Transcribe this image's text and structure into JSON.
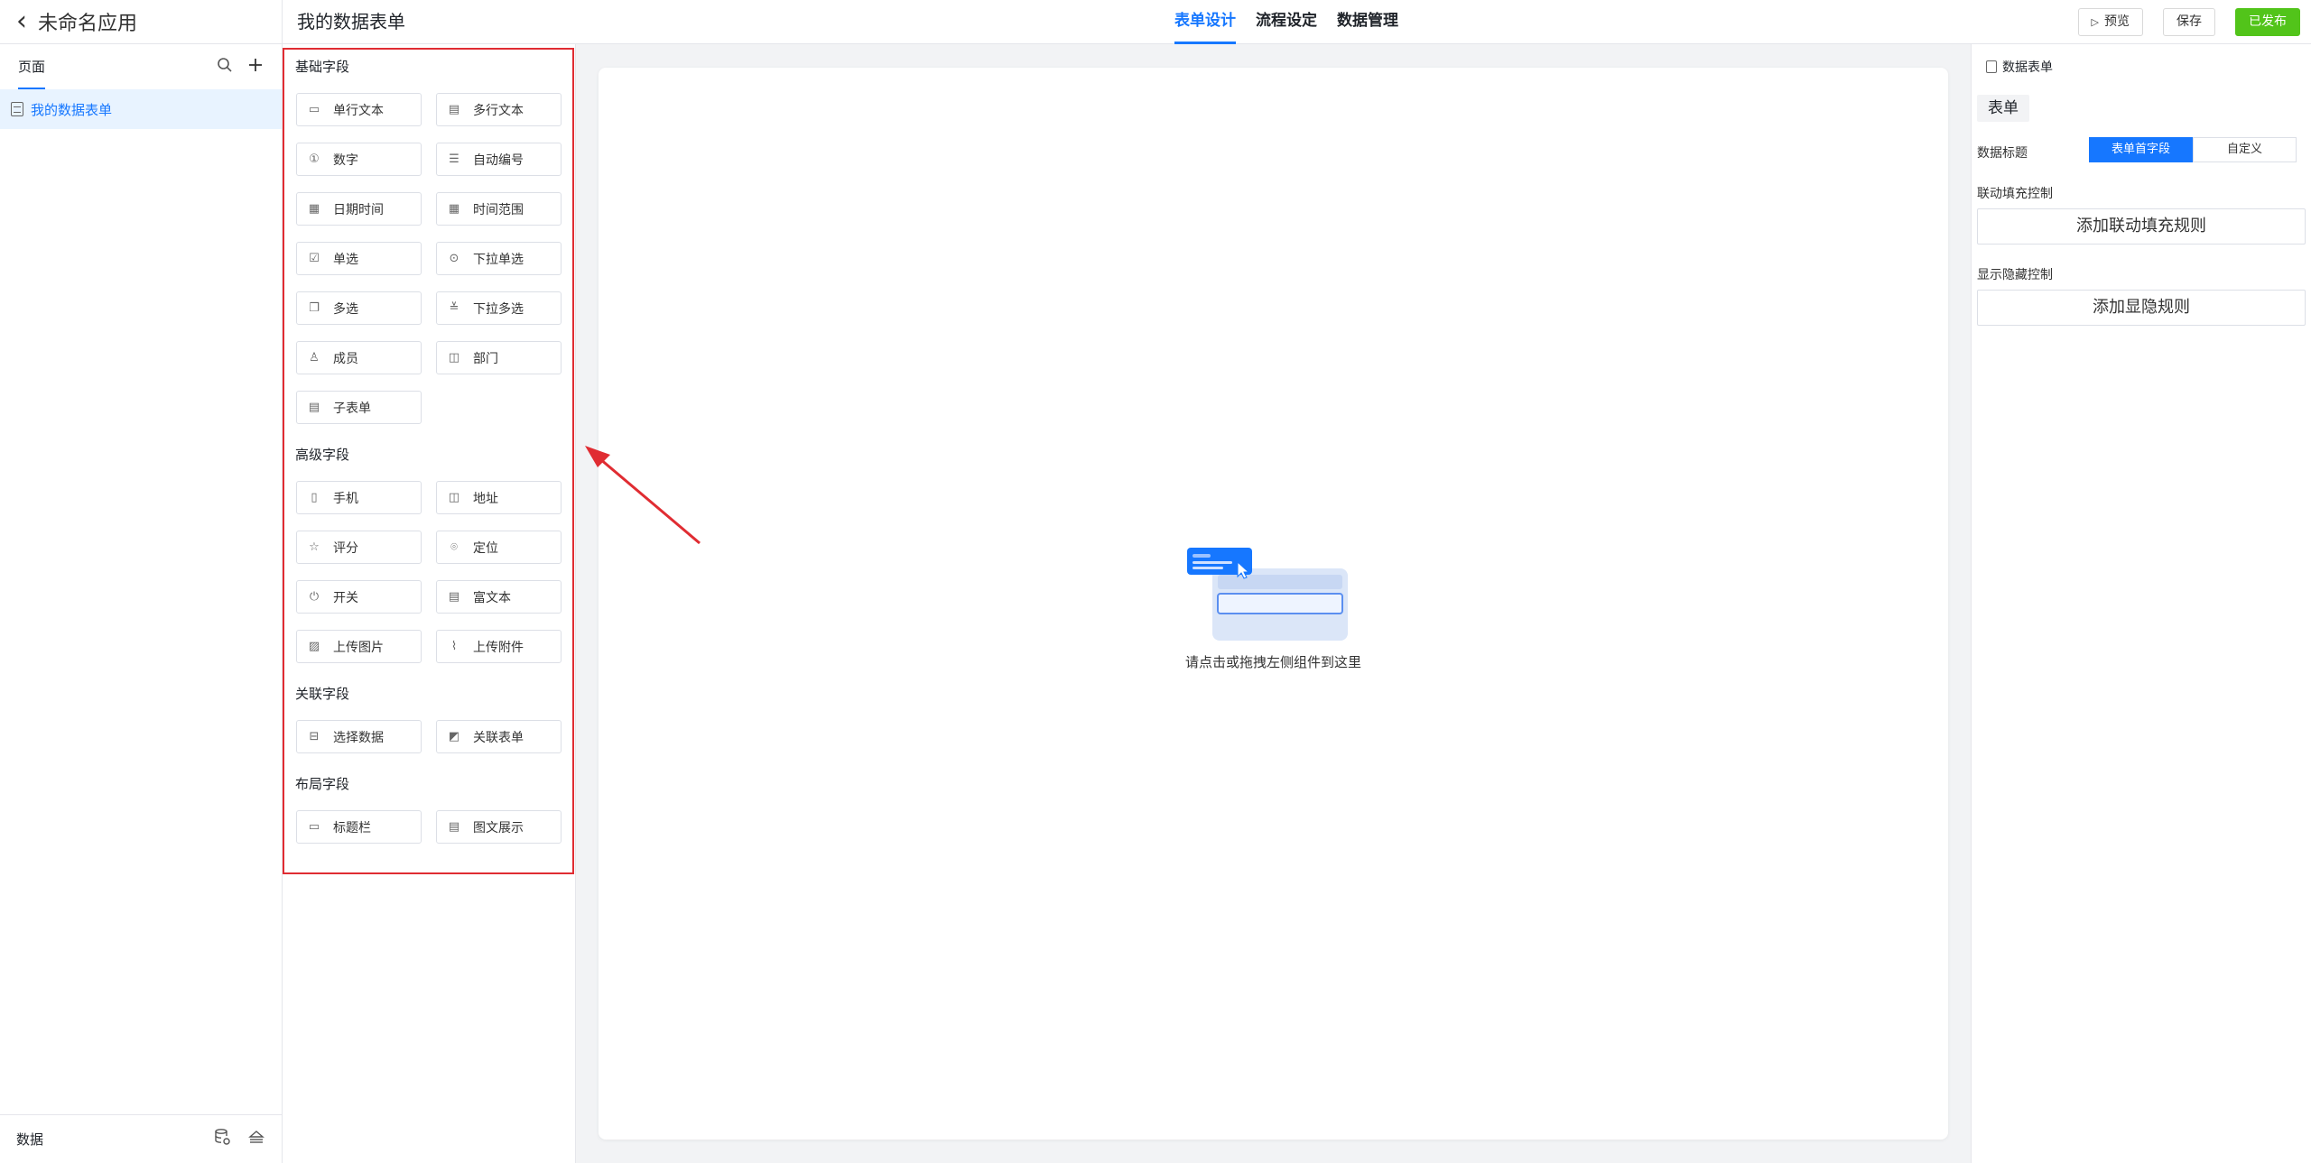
{
  "app": {
    "back_icon": "chevron-left-icon",
    "name": "未命名应用"
  },
  "sidebar": {
    "pages_tab": "页面",
    "items": [
      {
        "label": "我的数据表单",
        "icon": "form-icon",
        "active": true
      }
    ],
    "footer_label": "数据"
  },
  "header": {
    "form_title": "我的数据表单",
    "tabs": [
      {
        "label": "表单设计",
        "active": true
      },
      {
        "label": "流程设定",
        "active": false
      },
      {
        "label": "数据管理",
        "active": false
      }
    ],
    "preview_label": "预览",
    "save_label": "保存",
    "publish_label": "已发布"
  },
  "components": {
    "basic": {
      "title": "基础字段",
      "items": [
        "单行文本",
        "多行文本",
        "数字",
        "自动编号",
        "日期时间",
        "时间范围",
        "单选",
        "下拉单选",
        "多选",
        "下拉多选",
        "成员",
        "部门",
        "子表单"
      ]
    },
    "advanced": {
      "title": "高级字段",
      "items": [
        "手机",
        "地址",
        "评分",
        "定位",
        "开关",
        "富文本",
        "上传图片",
        "上传附件"
      ]
    },
    "relation": {
      "title": "关联字段",
      "items": [
        "选择数据",
        "关联表单"
      ]
    },
    "layout": {
      "title": "布局字段",
      "items": [
        "标题栏",
        "图文展示"
      ]
    }
  },
  "canvas": {
    "empty_text": "请点击或拖拽左侧组件到这里"
  },
  "right_panel": {
    "header": "数据表单",
    "chip": "表单",
    "data_title_label": "数据标题",
    "segments": [
      {
        "label": "表单首字段",
        "active": true
      },
      {
        "label": "自定义",
        "active": false
      }
    ],
    "linkage_label": "联动填充控制",
    "linkage_button": "添加联动填充规则",
    "visibility_label": "显示隐藏控制",
    "visibility_button": "添加显隐规则"
  },
  "colors": {
    "accent": "#1677ff",
    "publish": "#52c41a",
    "highlight_border": "#e02c32"
  }
}
